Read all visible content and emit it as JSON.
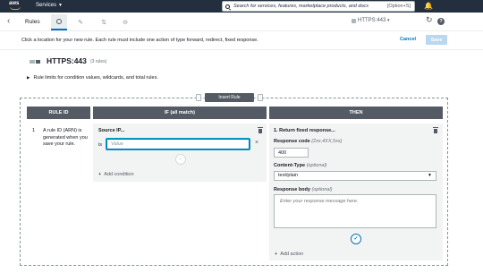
{
  "topbar": {
    "logo_text": "aws",
    "services_label": "Services",
    "services_caret": "▼",
    "search_placeholder": "Search for services, features, marketplace products, and docs",
    "search_shortcut": "[Option+S]",
    "bell_glyph": "🔔"
  },
  "toolbar": {
    "back_glyph": "‹",
    "title": "Rules",
    "tab_icons": [
      "add-rule-icon",
      "edit-icon",
      "reorder-icon",
      "delete-icon"
    ],
    "tab_glyphs": [
      "",
      "✎",
      "⇅",
      "⊖"
    ],
    "listener": "HTTPS:443",
    "listener_caret": "▾",
    "refresh_glyph": "↻",
    "help_glyph": "?"
  },
  "instructions": {
    "text": "Click a location for your new rule. Each rule must include one action of type forward, redirect, fixed response.",
    "cancel_label": "Cancel",
    "save_label": "Save"
  },
  "listener": {
    "name": "HTTPS:443",
    "count": "(3 rules)"
  },
  "limits": {
    "toggle_glyph": "▶",
    "text": "Rule limits for condition values, wildcards, and total rules."
  },
  "insert": {
    "left_glyph": "⋮",
    "label": "Insert Rule",
    "right_glyph": "⋮"
  },
  "headers": {
    "rule_id": "RULE ID",
    "if": "IF (all match)",
    "then": "THEN"
  },
  "rule": {
    "number": "1",
    "description": "A rule ID (ARN) is generated when you save your rule."
  },
  "condition": {
    "title": "Source IP...",
    "operator": "is",
    "value_placeholder": "Value",
    "remove_glyph": "×",
    "confirm_glyph": "✓",
    "add_plus": "+",
    "add_label": "Add condition"
  },
  "action": {
    "title": "1. Return fixed response...",
    "response_code_label": "Response code",
    "response_code_hint": "(2xx,4XX,5xx)",
    "response_code_value": "400",
    "content_type_label": "Content-Type",
    "content_type_hint": "(optional)",
    "content_type_value": "text/plain",
    "content_type_caret": "▼",
    "body_label": "Response body",
    "body_hint": "(optional)",
    "body_placeholder": "Enter your response message here.",
    "confirm_glyph": "✓",
    "add_plus": "+",
    "add_label": "Add action"
  },
  "colors": {
    "nav_bg": "#232f3e",
    "accent": "#0073bb",
    "header_bg": "#545b64",
    "panel_bg": "#f2f3f3",
    "orange": "#ff9900"
  }
}
